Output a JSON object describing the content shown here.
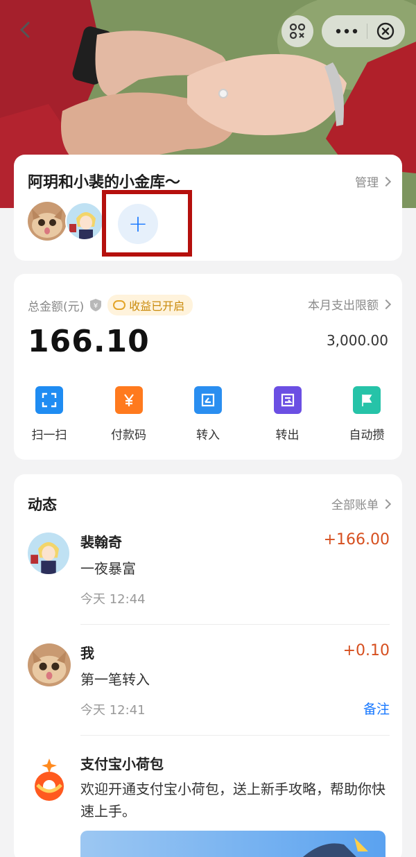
{
  "header": {
    "back_icon": "chevron-left-icon",
    "scan_icon": "mini-program-scan-icon",
    "more_icon": "more-dots-icon",
    "close_icon": "close-circle-icon"
  },
  "group": {
    "title": "阿玥和小裴的小金库～",
    "manage_label": "管理",
    "add_label": "+"
  },
  "balance": {
    "label": "总金额(元)",
    "badge": "收益已开启",
    "limit_label": "本月支出限额",
    "amount": "166.10",
    "limit": "3,000.00"
  },
  "actions": [
    {
      "label": "扫一扫",
      "icon": "scan-icon",
      "color": "#1f8cf2"
    },
    {
      "label": "付款码",
      "icon": "yuan-icon",
      "color": "#ff7a1e"
    },
    {
      "label": "转入",
      "icon": "transfer-in-icon",
      "color": "#2a8ef0"
    },
    {
      "label": "转出",
      "icon": "transfer-out-icon",
      "color": "#6b4fe3"
    },
    {
      "label": "自动攒",
      "icon": "flag-icon",
      "color": "#26c3a8"
    }
  ],
  "feed": {
    "title": "动态",
    "all_bills": "全部账单",
    "items": [
      {
        "name": "裴翰奇",
        "note": "一夜暴富",
        "time": "今天 12:44",
        "amount": "+166.00",
        "remark": ""
      },
      {
        "name": "我",
        "note": "第一笔转入",
        "time": "今天 12:41",
        "amount": "+0.10",
        "remark": "备注"
      }
    ],
    "promo": {
      "name": "支付宝小荷包",
      "text": "欢迎开通支付宝小荷包，送上新手攻略，帮助你快速上手。"
    }
  },
  "colors": {
    "accent": "#1677ff",
    "amount": "#d64f1f",
    "highlight": "#b5100d"
  }
}
